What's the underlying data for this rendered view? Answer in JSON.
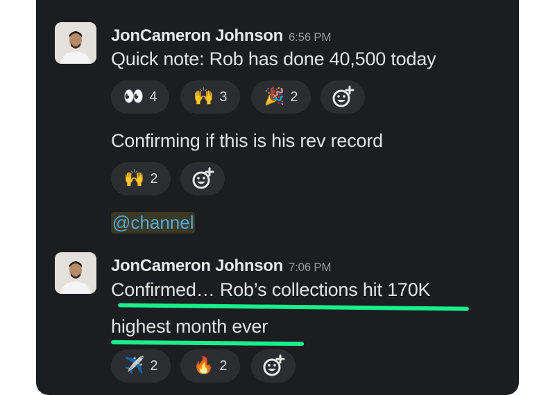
{
  "messages": [
    {
      "author": "JonCameron Johnson",
      "time": "6:56 PM",
      "lines": [
        "Quick note: Rob has done 40,500 today"
      ],
      "reactions": [
        {
          "emoji": "👀",
          "count": "4"
        },
        {
          "emoji": "🙌",
          "count": "3"
        },
        {
          "emoji": "🎉",
          "count": "2"
        }
      ],
      "followup": "Confirming if this is his rev record",
      "followup_reactions": [
        {
          "emoji": "🙌",
          "count": "2"
        }
      ],
      "mention": "@channel"
    },
    {
      "author": "JonCameron Johnson",
      "time": "7:06 PM",
      "lines": [
        "Confirmed… Rob’s collections hit 170K",
        "highest month ever"
      ],
      "reactions": [
        {
          "emoji": "✈️",
          "count": "2"
        },
        {
          "emoji": "🔥",
          "count": "2"
        }
      ]
    }
  ],
  "icons": {
    "add_reaction": "add-reaction-icon"
  },
  "colors": {
    "background": "#1b1d21",
    "highlight": "#19ef8a",
    "mention": "#53a9e0"
  }
}
